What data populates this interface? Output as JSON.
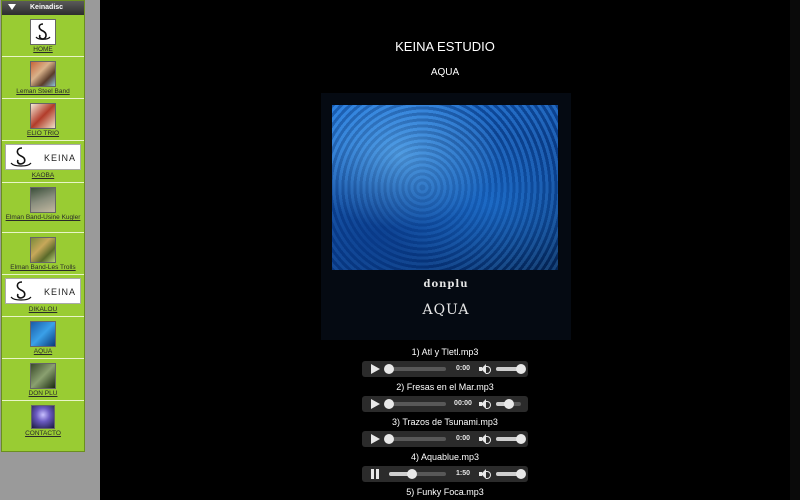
{
  "sidebar": {
    "title": "Keinadisc",
    "items": [
      {
        "label": "HOME",
        "icon": "keina-s-logo"
      },
      {
        "label": "Leman Steel Band",
        "icon": "band-photo"
      },
      {
        "label": "ELIO TRIO",
        "icon": "band-photo"
      },
      {
        "label": "KAOBA",
        "icon": "keina-logo",
        "logo_text": "KEINA"
      },
      {
        "label": "Elman Band-Usine Kugler",
        "icon": "album-cover"
      },
      {
        "label": "Elman Band-Les Trolls",
        "icon": "album-cover"
      },
      {
        "label": "DIKALOU",
        "icon": "keina-logo",
        "logo_text": "KEINA"
      },
      {
        "label": "AQUA",
        "icon": "album-cover"
      },
      {
        "label": "DON PLU",
        "icon": "album-cover"
      },
      {
        "label": "CONTACTO",
        "icon": "contact-image"
      }
    ]
  },
  "main": {
    "site_title": "KEINA ESTUDIO",
    "album_title": "AQUA",
    "cover": {
      "brand": "donplu",
      "title": "AQUA"
    }
  },
  "tracks": [
    {
      "name": "1) Atl y Tletl.mp3",
      "time": "0:00",
      "progress": 0.0,
      "volume": 1.0,
      "state": "paused"
    },
    {
      "name": "2) Fresas en el Mar.mp3",
      "time": "00:00",
      "progress": 0.0,
      "volume": 0.5,
      "state": "paused"
    },
    {
      "name": "3) Trazos de Tsunami.mp3",
      "time": "0:00",
      "progress": 0.0,
      "volume": 1.0,
      "state": "paused"
    },
    {
      "name": "4) Aquablue.mp3",
      "time": "1:50",
      "progress": 0.4,
      "volume": 1.0,
      "state": "playing"
    },
    {
      "name": "5) Funky Foca.mp3"
    }
  ],
  "colors": {
    "sidebar_bg": "#99cc33",
    "page_bg": "#000000",
    "player_bg": "#2b2b2b"
  }
}
